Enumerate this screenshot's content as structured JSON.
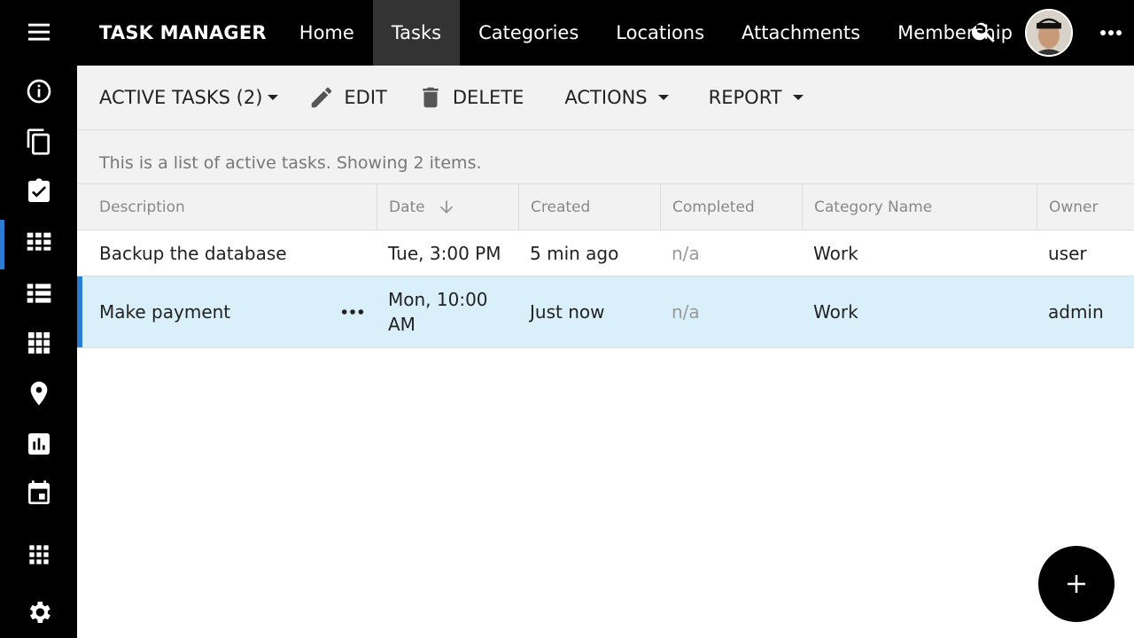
{
  "app": {
    "title": "TASK MANAGER"
  },
  "nav": [
    "Home",
    "Tasks",
    "Categories",
    "Locations",
    "Attachments",
    "Membership"
  ],
  "commands": {
    "view": "ACTIVE TASKS (2)",
    "edit": "EDIT",
    "delete": "DELETE",
    "actions": "ACTIONS",
    "report": "REPORT"
  },
  "status_text": "This is a list of active tasks. Showing 2 items.",
  "table": {
    "columns": [
      "Description",
      "Date",
      "Created",
      "Completed",
      "Category Name",
      "Owner"
    ],
    "rows": [
      {
        "description": "Backup the database",
        "date": "Tue, 3:00 PM",
        "created": "5 min ago",
        "completed": "n/a",
        "category": "Work",
        "owner": "user"
      },
      {
        "description": "Make payment",
        "date": "Mon, 10:00 AM",
        "created": "Just now",
        "completed": "n/a",
        "category": "Work",
        "owner": "admin"
      }
    ]
  },
  "icons": {
    "sidebar": [
      "menu-icon",
      "info-icon",
      "copy-icon",
      "task-check-icon",
      "grid-icon",
      "list-icon",
      "tiles-icon",
      "location-icon",
      "chart-icon",
      "calendar-icon",
      "apps-icon",
      "settings-icon"
    ],
    "topbar": [
      "search-icon",
      "avatar",
      "more-icon"
    ],
    "fab": "add-icon"
  },
  "colors": {
    "accent": "#2b7cd3",
    "selected_row": "#d9f0fb",
    "bar": "#000000"
  }
}
